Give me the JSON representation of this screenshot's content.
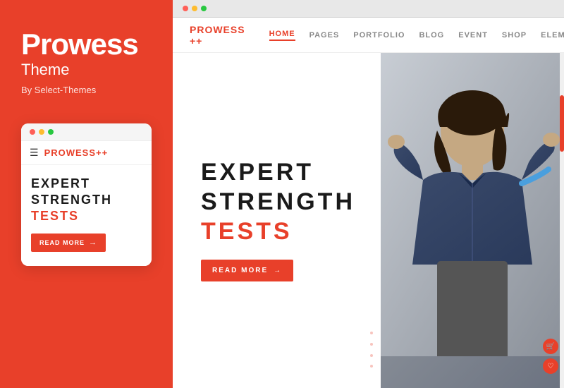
{
  "sidebar": {
    "title": "Prowess",
    "subtitle": "Theme",
    "by": "By Select-Themes",
    "mobile_card": {
      "logo": "PROWESS",
      "logo_plus": "++",
      "hero_line1": "EXPERT",
      "hero_line2": "STRENGTH",
      "hero_accent": "TESTS",
      "btn_label": "READ MORE"
    }
  },
  "browser": {
    "dots": [
      "red",
      "yellow",
      "green"
    ]
  },
  "website": {
    "logo": "PROWESS",
    "logo_plus": "++",
    "nav_items": [
      "HOME",
      "PAGES",
      "PORTFOLIO",
      "BLOG",
      "EVENT",
      "SHOP",
      "ELEMENTS"
    ],
    "hero": {
      "line1": "EXPERT",
      "line2": "STRENGTH",
      "accent": "TESTS",
      "btn_label": "READ MORE"
    }
  }
}
